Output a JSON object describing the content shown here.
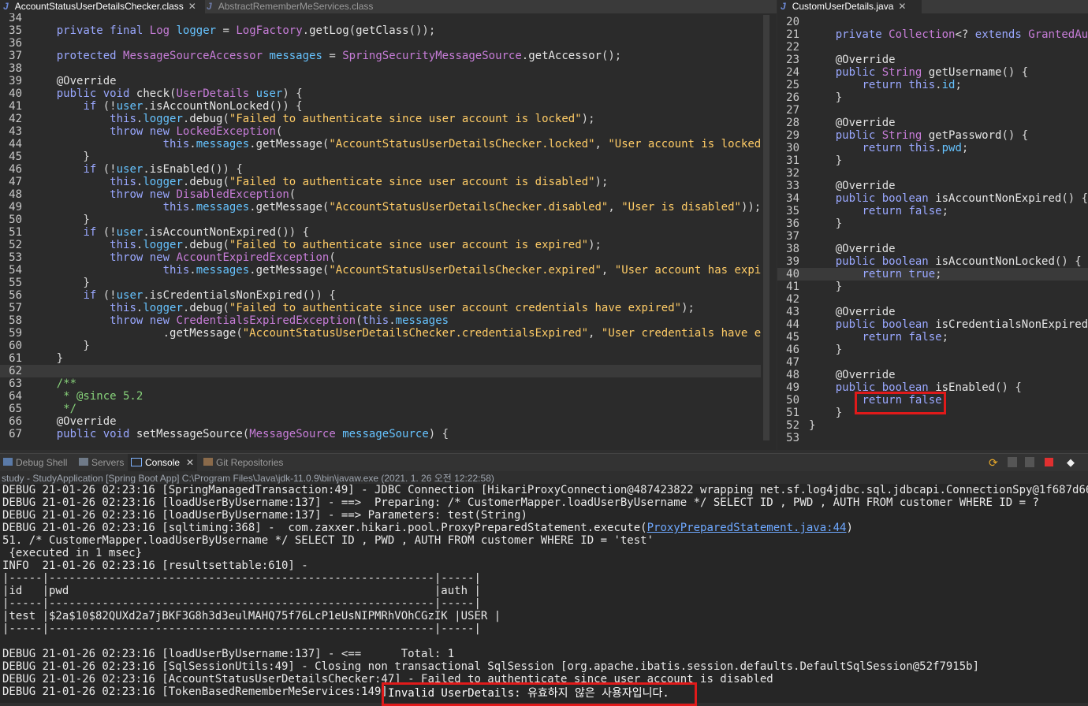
{
  "left_editor": {
    "tabs": [
      {
        "label": "AccountStatusUserDetailsChecker.class",
        "active": true
      },
      {
        "label": "AbstractRememberMeServices.class",
        "active": false
      }
    ],
    "lines": [
      {
        "n": "34",
        "t": ""
      },
      {
        "n": "35",
        "t": "    private final Log logger = LogFactory.getLog(getClass());"
      },
      {
        "n": "36",
        "t": ""
      },
      {
        "n": "37",
        "t": "    protected MessageSourceAccessor messages = SpringSecurityMessageSource.getAccessor();"
      },
      {
        "n": "38",
        "t": ""
      },
      {
        "n": "39",
        "t": "    @Override"
      },
      {
        "n": "40",
        "t": "    public void check(UserDetails user) {"
      },
      {
        "n": "41",
        "t": "        if (!user.isAccountNonLocked()) {"
      },
      {
        "n": "42",
        "t": "            this.logger.debug(\"Failed to authenticate since user account is locked\");"
      },
      {
        "n": "43",
        "t": "            throw new LockedException("
      },
      {
        "n": "44",
        "t": "                    this.messages.getMessage(\"AccountStatusUserDetailsChecker.locked\", \"User account is locked\"));"
      },
      {
        "n": "45",
        "t": "        }"
      },
      {
        "n": "46",
        "t": "        if (!user.isEnabled()) {"
      },
      {
        "n": "47",
        "t": "            this.logger.debug(\"Failed to authenticate since user account is disabled\");"
      },
      {
        "n": "48",
        "t": "            throw new DisabledException("
      },
      {
        "n": "49",
        "t": "                    this.messages.getMessage(\"AccountStatusUserDetailsChecker.disabled\", \"User is disabled\"));"
      },
      {
        "n": "50",
        "t": "        }"
      },
      {
        "n": "51",
        "t": "        if (!user.isAccountNonExpired()) {"
      },
      {
        "n": "52",
        "t": "            this.logger.debug(\"Failed to authenticate since user account is expired\");"
      },
      {
        "n": "53",
        "t": "            throw new AccountExpiredException("
      },
      {
        "n": "54",
        "t": "                    this.messages.getMessage(\"AccountStatusUserDetailsChecker.expired\", \"User account has expired\"));"
      },
      {
        "n": "55",
        "t": "        }"
      },
      {
        "n": "56",
        "t": "        if (!user.isCredentialsNonExpired()) {"
      },
      {
        "n": "57",
        "t": "            this.logger.debug(\"Failed to authenticate since user account credentials have expired\");"
      },
      {
        "n": "58",
        "t": "            throw new CredentialsExpiredException(this.messages"
      },
      {
        "n": "59",
        "t": "                    .getMessage(\"AccountStatusUserDetailsChecker.credentialsExpired\", \"User credentials have expired\"));"
      },
      {
        "n": "60",
        "t": "        }"
      },
      {
        "n": "61",
        "t": "    }"
      },
      {
        "n": "62",
        "t": ""
      },
      {
        "n": "63",
        "t": "    /**"
      },
      {
        "n": "64",
        "t": "     * @since 5.2"
      },
      {
        "n": "65",
        "t": "     */"
      },
      {
        "n": "66",
        "t": "    @Override"
      },
      {
        "n": "67",
        "t": "    public void setMessageSource(MessageSource messageSource) {"
      }
    ]
  },
  "right_editor": {
    "tabs": [
      {
        "label": "CustomUserDetails.java",
        "active": true
      }
    ],
    "lines": [
      {
        "n": "20",
        "t": ""
      },
      {
        "n": "21",
        "t": "    private Collection<? extends GrantedAuthority> authorities;"
      },
      {
        "n": "22",
        "t": ""
      },
      {
        "n": "23",
        "t": "    @Override"
      },
      {
        "n": "24",
        "t": "    public String getUsername() {"
      },
      {
        "n": "25",
        "t": "        return this.id;"
      },
      {
        "n": "26",
        "t": "    }"
      },
      {
        "n": "27",
        "t": ""
      },
      {
        "n": "28",
        "t": "    @Override"
      },
      {
        "n": "29",
        "t": "    public String getPassword() {"
      },
      {
        "n": "30",
        "t": "        return this.pwd;"
      },
      {
        "n": "31",
        "t": "    }"
      },
      {
        "n": "32",
        "t": ""
      },
      {
        "n": "33",
        "t": "    @Override"
      },
      {
        "n": "34",
        "t": "    public boolean isAccountNonExpired() {"
      },
      {
        "n": "35",
        "t": "        return false;"
      },
      {
        "n": "36",
        "t": "    }"
      },
      {
        "n": "37",
        "t": ""
      },
      {
        "n": "38",
        "t": "    @Override"
      },
      {
        "n": "39",
        "t": "    public boolean isAccountNonLocked() {"
      },
      {
        "n": "40",
        "t": "        return true;"
      },
      {
        "n": "41",
        "t": "    }"
      },
      {
        "n": "42",
        "t": ""
      },
      {
        "n": "43",
        "t": "    @Override"
      },
      {
        "n": "44",
        "t": "    public boolean isCredentialsNonExpired() {"
      },
      {
        "n": "45",
        "t": "        return false;"
      },
      {
        "n": "46",
        "t": "    }"
      },
      {
        "n": "47",
        "t": ""
      },
      {
        "n": "48",
        "t": "    @Override"
      },
      {
        "n": "49",
        "t": "    public boolean isEnabled() {"
      },
      {
        "n": "50",
        "t": "        return false;"
      },
      {
        "n": "51",
        "t": "    }"
      },
      {
        "n": "52",
        "t": "}"
      },
      {
        "n": "53",
        "t": ""
      }
    ]
  },
  "console_tabs": [
    "Debug Shell",
    "Servers",
    "Console",
    "Git Repositories"
  ],
  "console_active_tab": "Console",
  "console_header": "study - StudyApplication [Spring Boot App] C:\\Program Files\\Java\\jdk-11.0.9\\bin\\javaw.exe  (2021. 1. 26 오전 12:22:58)",
  "console_lines": [
    "DEBUG 21-01-26 02:23:16 [SpringManagedTransaction:49] - JDBC Connection [HikariProxyConnection@487423822 wrapping net.sf.log4jdbc.sql.jdbcapi.ConnectionSpy@1f687d66] will n",
    "DEBUG 21-01-26 02:23:16 [loadUserByUsername:137] - ==>  Preparing: /* CustomerMapper.loadUserByUsername */ SELECT ID , PWD , AUTH FROM customer WHERE ID = ?",
    "DEBUG 21-01-26 02:23:16 [loadUserByUsername:137] - ==> Parameters: test(String)",
    "DEBUG 21-01-26 02:23:16 [sqltiming:368] -  com.zaxxer.hikari.pool.ProxyPreparedStatement.execute(",
    "51. /* CustomerMapper.loadUserByUsername */ SELECT ID , PWD , AUTH FROM customer WHERE ID = 'test'",
    " {executed in 1 msec}",
    "INFO  21-01-26 02:23:16 [resultsettable:610] -",
    "|-----|----------------------------------------------------------|-----|",
    "|id   |pwd                                                       |auth |",
    "|-----|----------------------------------------------------------|-----|",
    "|test |$2a$10$82QUXd2a7jBKF3G8h3d3eulMAHQ75f76LcP1eUsNIPMRhVOhCGzIK |USER |",
    "|-----|----------------------------------------------------------|-----|",
    "",
    "DEBUG 21-01-26 02:23:16 [loadUserByUsername:137] - <==      Total: 1",
    "DEBUG 21-01-26 02:23:16 [SqlSessionUtils:49] - Closing non transactional SqlSession [org.apache.ibatis.session.defaults.DefaultSqlSession@52f7915b]",
    "DEBUG 21-01-26 02:23:16 [AccountStatusUserDetailsChecker:47] - Failed to authenticate since user account is disabled",
    "DEBUG 21-01-26 02:23:16 [TokenBasedRememberMeServices:149] - "
  ],
  "console_link": "ProxyPreparedStatement.java:44",
  "console_link_suffix": ")",
  "highlight_message": "Invalid UserDetails: 유효하지 않은 사용자입니다.",
  "highlight_code": "return false;",
  "colors": {
    "highlight_box": "#e01a1a",
    "editor_bg": "#2b2b2b",
    "console_bg": "#262626"
  }
}
